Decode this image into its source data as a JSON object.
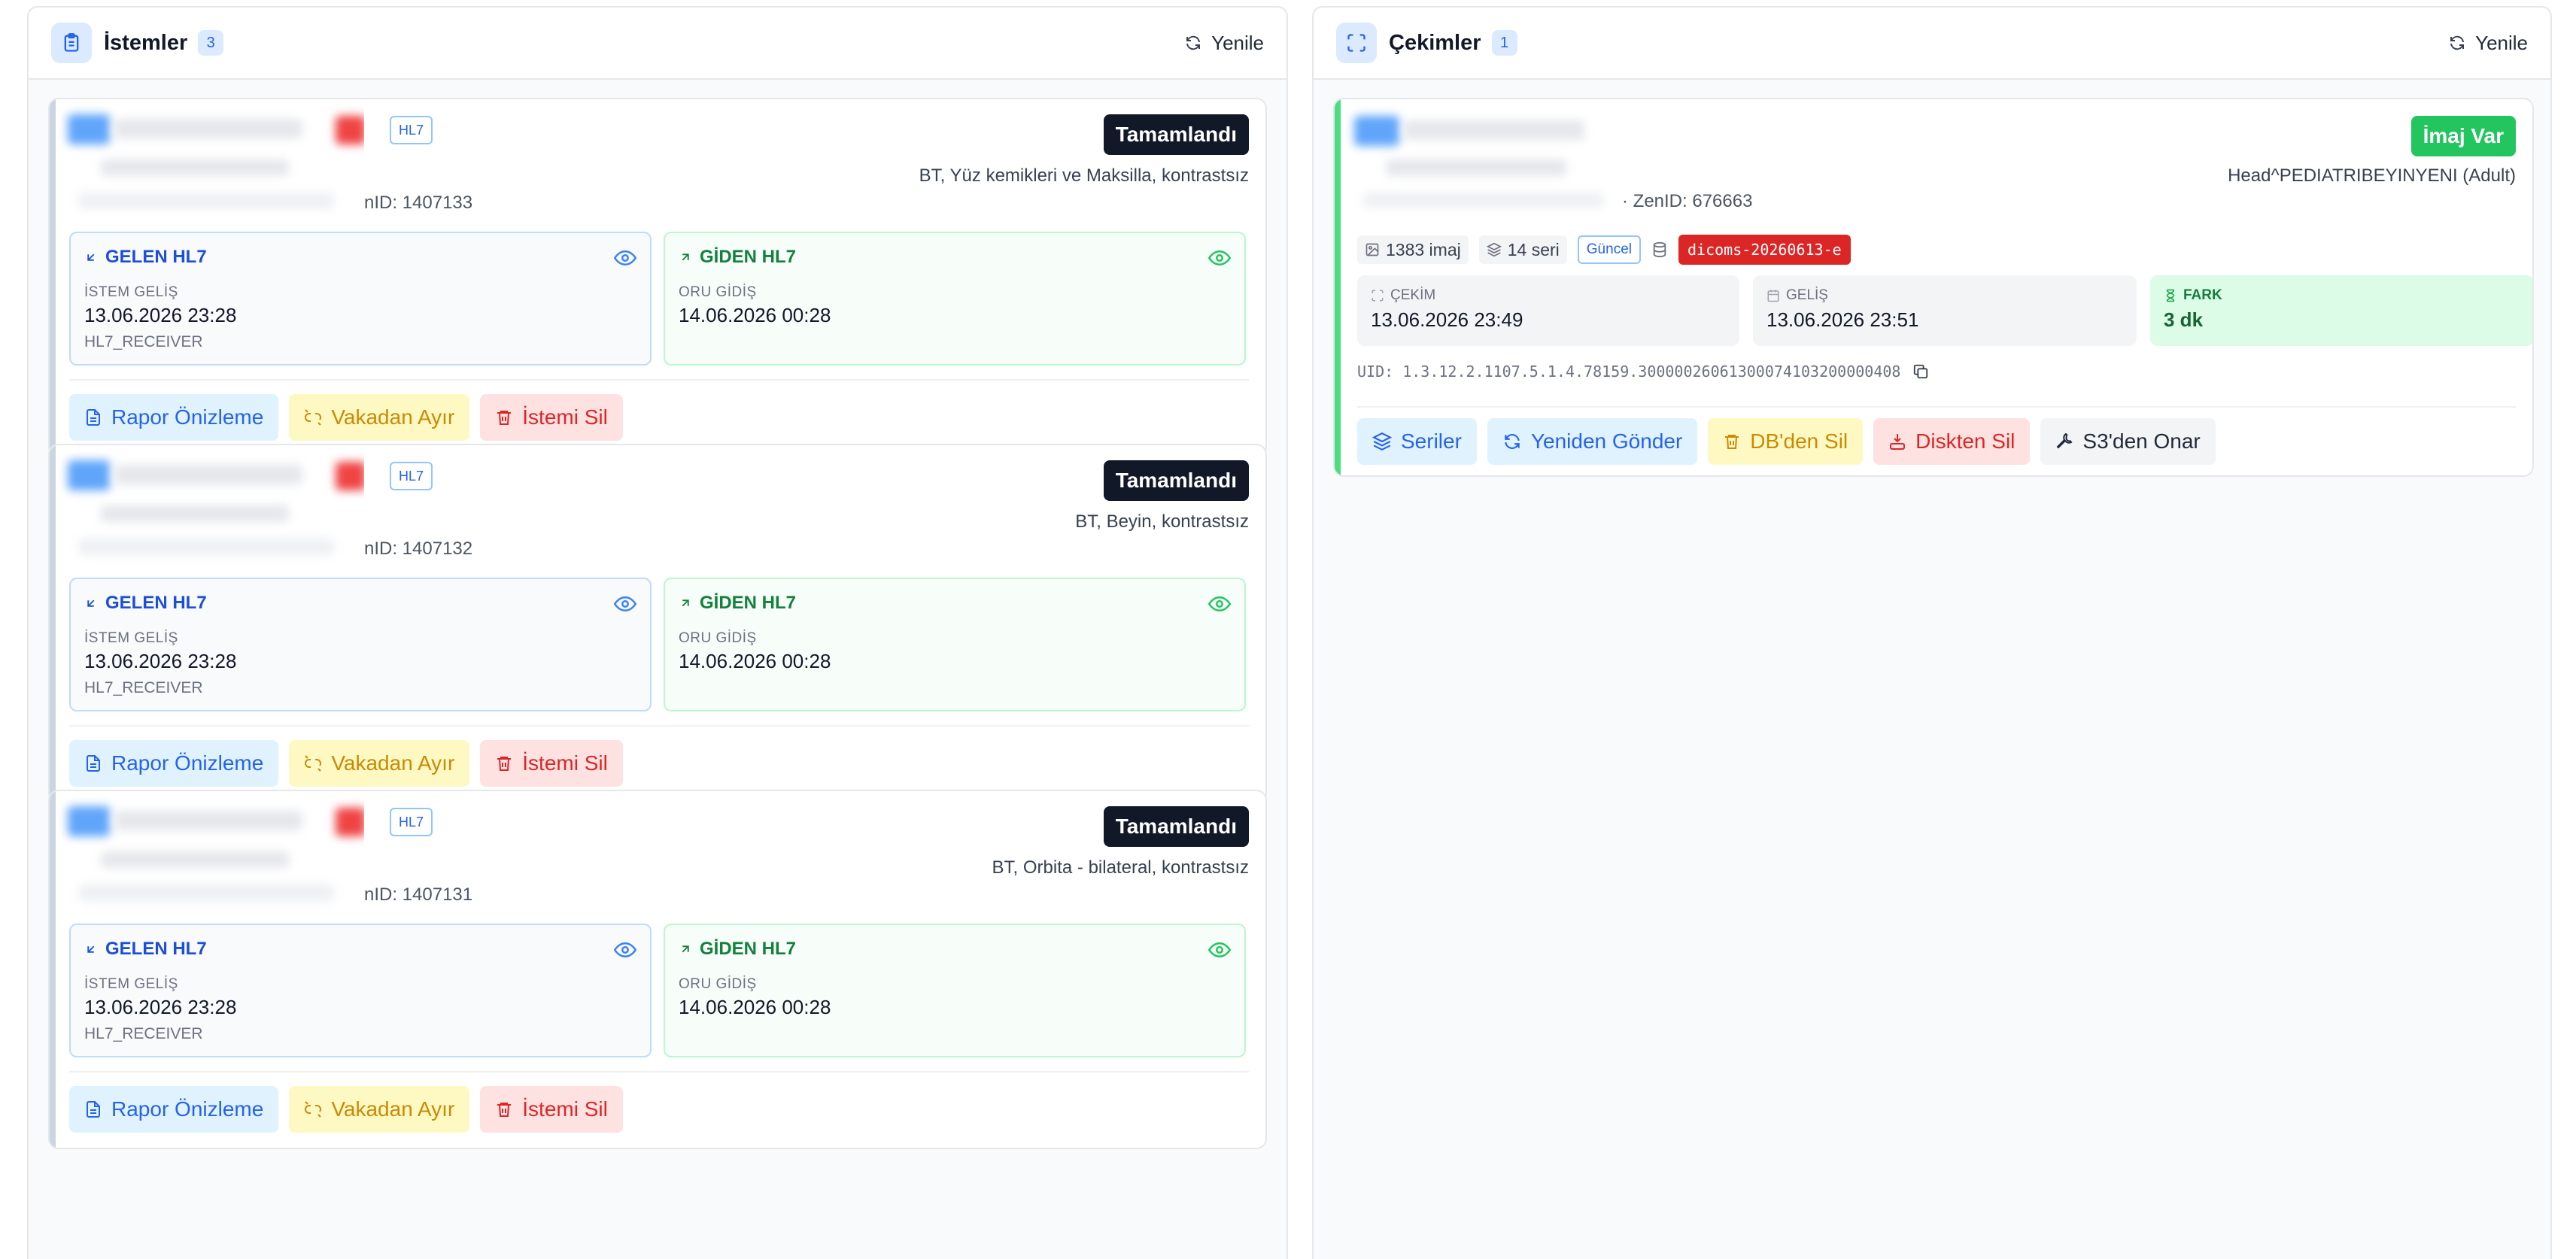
{
  "left_panel": {
    "title": "İstemler",
    "count": "3",
    "refresh_label": "Yenile"
  },
  "right_panel": {
    "title": "Çekimler",
    "count": "1",
    "refresh_label": "Yenile"
  },
  "orders": [
    {
      "tag": "HL7",
      "status": "Tamamlandı",
      "procedure": "BT, Yüz kemikleri ve Maksilla, kontrastsız",
      "zen_id": "nID: 1407133",
      "incoming": {
        "title": "GELEN HL7",
        "label": "İSTEM GELİŞ",
        "datetime": "13.06.2026 23:28",
        "receiver": "HL7_RECEIVER"
      },
      "outgoing": {
        "title": "GİDEN HL7",
        "label": "ORU GİDİŞ",
        "datetime": "14.06.2026 00:28"
      },
      "actions": {
        "preview": "Rapor Önizleme",
        "detach": "Vakadan Ayır",
        "delete": "İstemi Sil"
      }
    },
    {
      "tag": "HL7",
      "status": "Tamamlandı",
      "procedure": "BT, Beyin, kontrastsız",
      "zen_id": "nID: 1407132",
      "incoming": {
        "title": "GELEN HL7",
        "label": "İSTEM GELİŞ",
        "datetime": "13.06.2026 23:28",
        "receiver": "HL7_RECEIVER"
      },
      "outgoing": {
        "title": "GİDEN HL7",
        "label": "ORU GİDİŞ",
        "datetime": "14.06.2026 00:28"
      },
      "actions": {
        "preview": "Rapor Önizleme",
        "detach": "Vakadan Ayır",
        "delete": "İstemi Sil"
      }
    },
    {
      "tag": "HL7",
      "status": "Tamamlandı",
      "procedure": "BT, Orbita - bilateral, kontrastsız",
      "zen_id": "nID: 1407131",
      "incoming": {
        "title": "GELEN HL7",
        "label": "İSTEM GELİŞ",
        "datetime": "13.06.2026 23:28",
        "receiver": "HL7_RECEIVER"
      },
      "outgoing": {
        "title": "GİDEN HL7",
        "label": "ORU GİDİŞ",
        "datetime": "14.06.2026 00:28"
      },
      "actions": {
        "preview": "Rapor Önizleme",
        "detach": "Vakadan Ayır",
        "delete": "İstemi Sil"
      }
    }
  ],
  "study": {
    "status": "İmaj Var",
    "procedure": "Head^PEDIATRIBEYINYENI (Adult)",
    "zen_id": "· ZenID: 676663",
    "images": "1383 imaj",
    "series": "14 seri",
    "guncel": "Güncel",
    "dicoms": "dicoms-20260613-e",
    "capture_label": "ÇEKİM",
    "capture_value": "13.06.2026 23:49",
    "arrival_label": "GELİŞ",
    "arrival_value": "13.06.2026 23:51",
    "diff_label": "FARK",
    "diff_value": "3 dk",
    "uid": "UID: 1.3.12.2.1107.5.1.4.78159.30000026061300074103200000408",
    "actions": {
      "series": "Seriler",
      "resend": "Yeniden Gönder",
      "db_delete": "DB'den Sil",
      "disk_delete": "Diskten Sil",
      "s3_repair": "S3'den Onar"
    }
  },
  "colors": {
    "accent_blue": "#2563eb",
    "success_green": "#22c55e",
    "danger_red": "#dc2626",
    "warning_yellow": "#ca8a04",
    "dark": "#111827"
  }
}
